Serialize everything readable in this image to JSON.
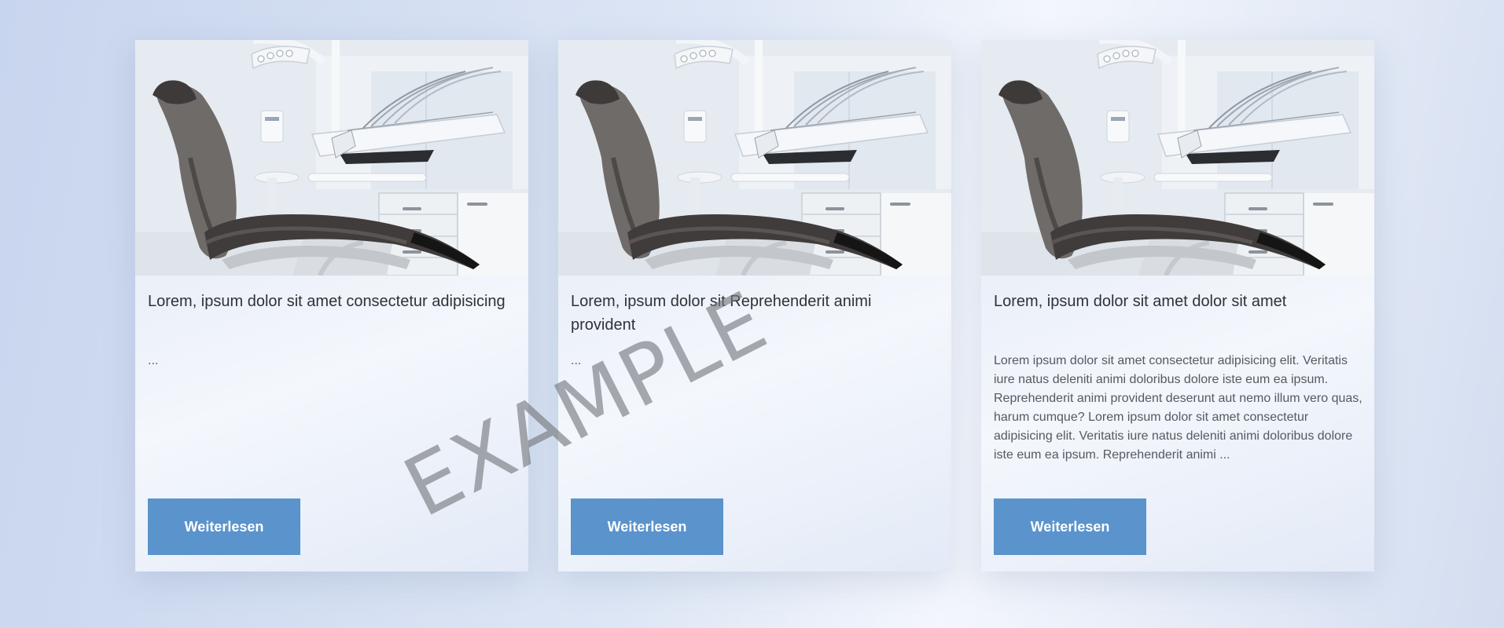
{
  "cards": [
    {
      "image_alt": "dental-chair-photo",
      "title": "Lorem, ipsum dolor sit amet consectetur adipisicing",
      "excerpt": "...",
      "button_label": "Weiterlesen"
    },
    {
      "image_alt": "dental-chair-photo",
      "title": "Lorem, ipsum dolor sit Reprehenderit animi provident",
      "excerpt": "...",
      "button_label": "Weiterlesen"
    },
    {
      "image_alt": "dental-chair-photo",
      "title": "Lorem, ipsum dolor sit amet dolor sit amet",
      "excerpt": "Lorem ipsum dolor sit amet consectetur adipisicing elit. Veritatis iure natus deleniti animi doloribus dolore iste eum ea ipsum. Reprehenderit animi provident deserunt aut nemo illum vero quas, harum cumque? Lorem ipsum dolor sit amet consectetur adipisicing elit. Veritatis iure natus deleniti animi doloribus dolore iste eum ea ipsum. Reprehenderit animi ...",
      "button_label": "Weiterlesen"
    }
  ],
  "watermark": "EXAMPLE",
  "colors": {
    "button": "#5b93cc",
    "button_text": "#ffffff",
    "title_text": "#2f3338",
    "body_text": "#555a60",
    "watermark": "#73767a"
  }
}
